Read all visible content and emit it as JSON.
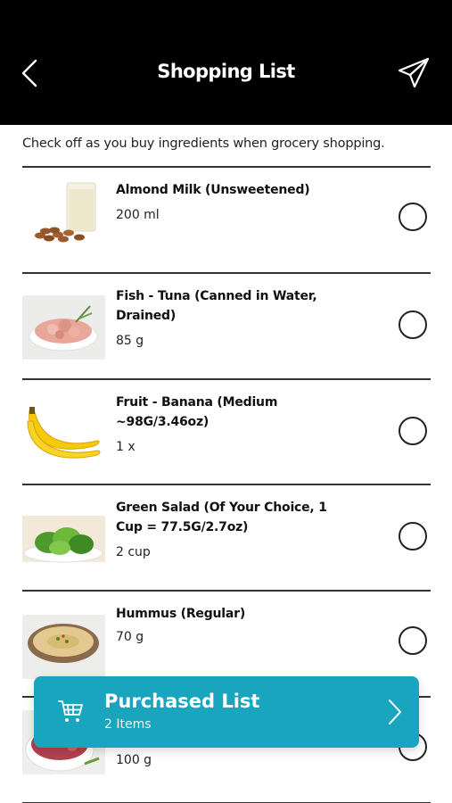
{
  "header": {
    "title": "Shopping List",
    "back_icon": "chevron-left-icon",
    "send_icon": "paper-plane-icon"
  },
  "intro_text": "Check off as you buy ingredients when grocery shopping.",
  "items": [
    {
      "name": "Almond Milk (Unsweetened)",
      "quantity": "200 ml",
      "checked": false,
      "image": "almond-milk"
    },
    {
      "name": "Fish - Tuna (Canned in Water, Drained)",
      "quantity": "85 g",
      "checked": false,
      "image": "tuna"
    },
    {
      "name": "Fruit - Banana (Medium ~98G/3.46oz)",
      "quantity": "1 x",
      "checked": false,
      "image": "banana"
    },
    {
      "name": "Green Salad (Of Your Choice, 1 Cup = 77.5G/2.7oz)",
      "quantity": "2 cup",
      "checked": false,
      "image": "salad"
    },
    {
      "name": "Hummus (Regular)",
      "quantity": "70 g",
      "checked": false,
      "image": "hummus"
    },
    {
      "name": "",
      "quantity": "100 g",
      "checked": false,
      "image": "ground-meat"
    }
  ],
  "purchased": {
    "title": "Purchased List",
    "count": "2 Items",
    "icon": "cart-icon"
  },
  "colors": {
    "header_bg": "#000000",
    "accent": "#18a5bd"
  }
}
